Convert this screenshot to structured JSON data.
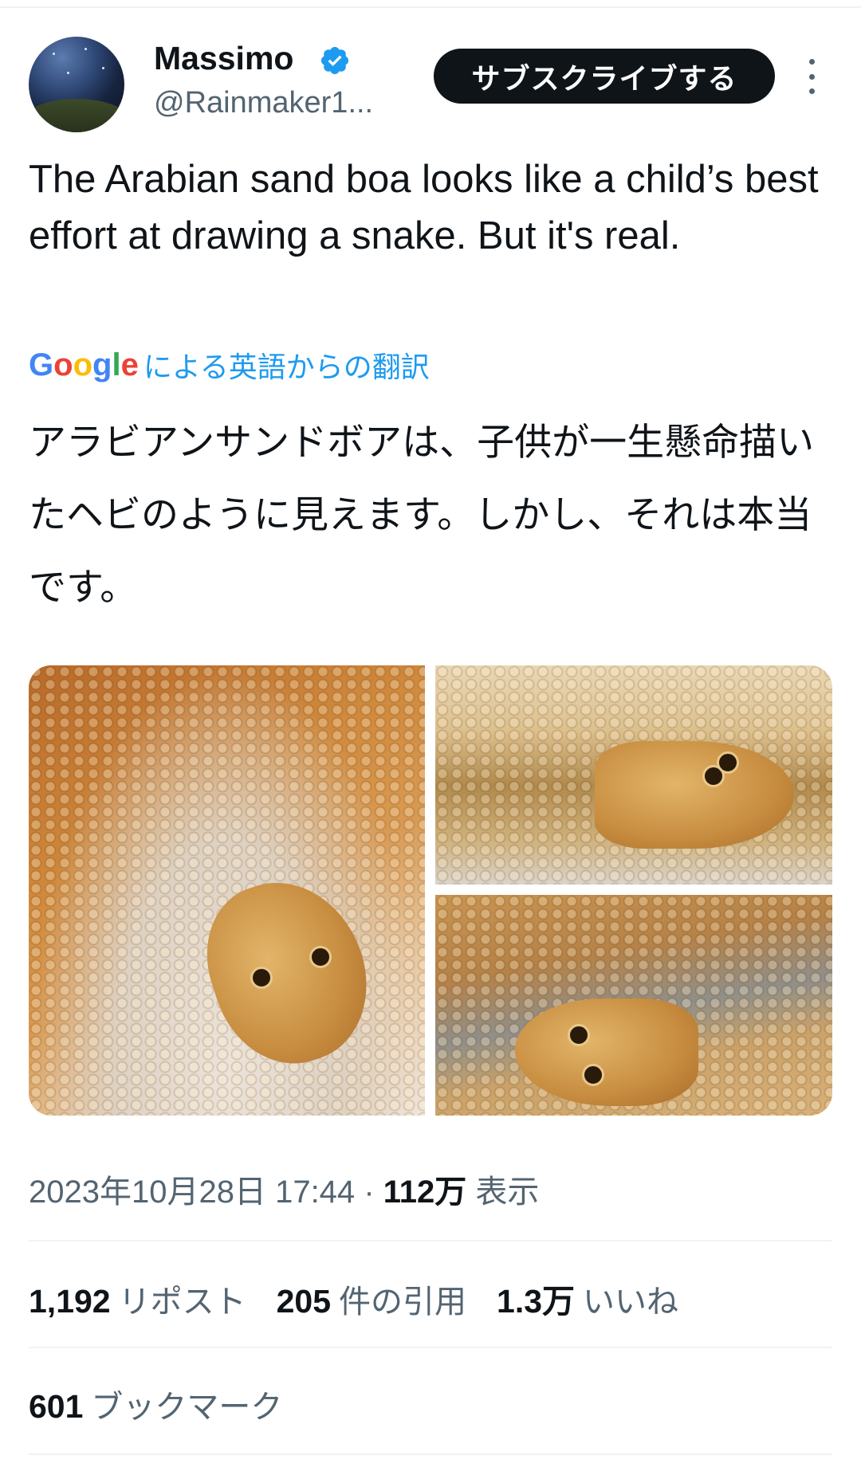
{
  "author": {
    "name": "Massimo",
    "handle": "@Rainmaker1...",
    "verified": true
  },
  "header": {
    "subscribe_label": "サブスクライブする",
    "more_icon": "more-vertical-icon"
  },
  "tweet": {
    "text": "The Arabian sand boa looks like a child’s best effort at drawing a snake. But it's real.",
    "translation_source": "による英語からの翻訳",
    "translation_provider": "Google",
    "translated_text": "アラビアンサンドボアは、子供が一生懸命描いたヘビのように見えます。しかし、それは本当です。"
  },
  "media": {
    "count": 3,
    "images": [
      "snake-photo-1",
      "snake-photo-2",
      "snake-photo-3"
    ]
  },
  "meta": {
    "timestamp": "2023年10月28日 17:44",
    "separator": "·",
    "views_count": "112万",
    "views_label": "表示"
  },
  "stats": {
    "reposts_count": "1,192",
    "reposts_label": "リポスト",
    "quotes_count": "205",
    "quotes_label": "件の引用",
    "likes_count": "1.3万",
    "likes_label": "いいね",
    "bookmarks_count": "601",
    "bookmarks_label": "ブックマーク"
  },
  "colors": {
    "text": "#0f1419",
    "secondary": "#536471",
    "link": "#1d9bf0",
    "verified": "#1d9bf0",
    "divider": "#eff3f4"
  }
}
